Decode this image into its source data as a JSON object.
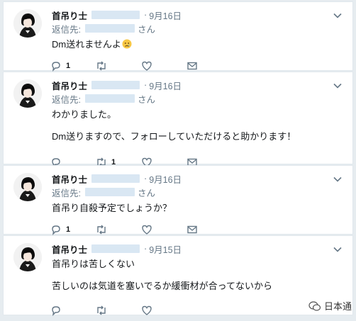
{
  "tweets": [
    {
      "name": "首吊り士",
      "sep": "·",
      "date": "9月16日",
      "reply_prefix": "返信先:",
      "reply_suffix": "さん",
      "lines": [
        "Dm送れませんよ"
      ],
      "has_emoji": true,
      "reply_count": "1",
      "retweet_count": ""
    },
    {
      "name": "首吊り士",
      "sep": "·",
      "date": "9月16日",
      "reply_prefix": "返信先:",
      "reply_suffix": "さん",
      "lines": [
        "わかりました。",
        "",
        "Dm送りますので、フォローしていただけると助かります！"
      ],
      "has_emoji": false,
      "reply_count": "",
      "retweet_count": "1"
    },
    {
      "name": "首吊り士",
      "sep": "·",
      "date": "9月16日",
      "reply_prefix": "返信先:",
      "reply_suffix": "さん",
      "lines": [
        "首吊り自殺予定でしょうか？"
      ],
      "has_emoji": false,
      "reply_count": "1",
      "retweet_count": ""
    },
    {
      "name": "首吊り士",
      "sep": "·",
      "date": "9月15日",
      "reply_prefix": "",
      "reply_suffix": "",
      "lines": [
        "首吊りは苦しくない",
        "",
        "苦しいのは気道を塞いでるか緩衝材が合ってないから"
      ],
      "has_emoji": false,
      "reply_count": "",
      "retweet_count": ""
    }
  ],
  "watermark": "日本通",
  "colors": {
    "icon": "#657786",
    "background": "#e6ecf0"
  }
}
